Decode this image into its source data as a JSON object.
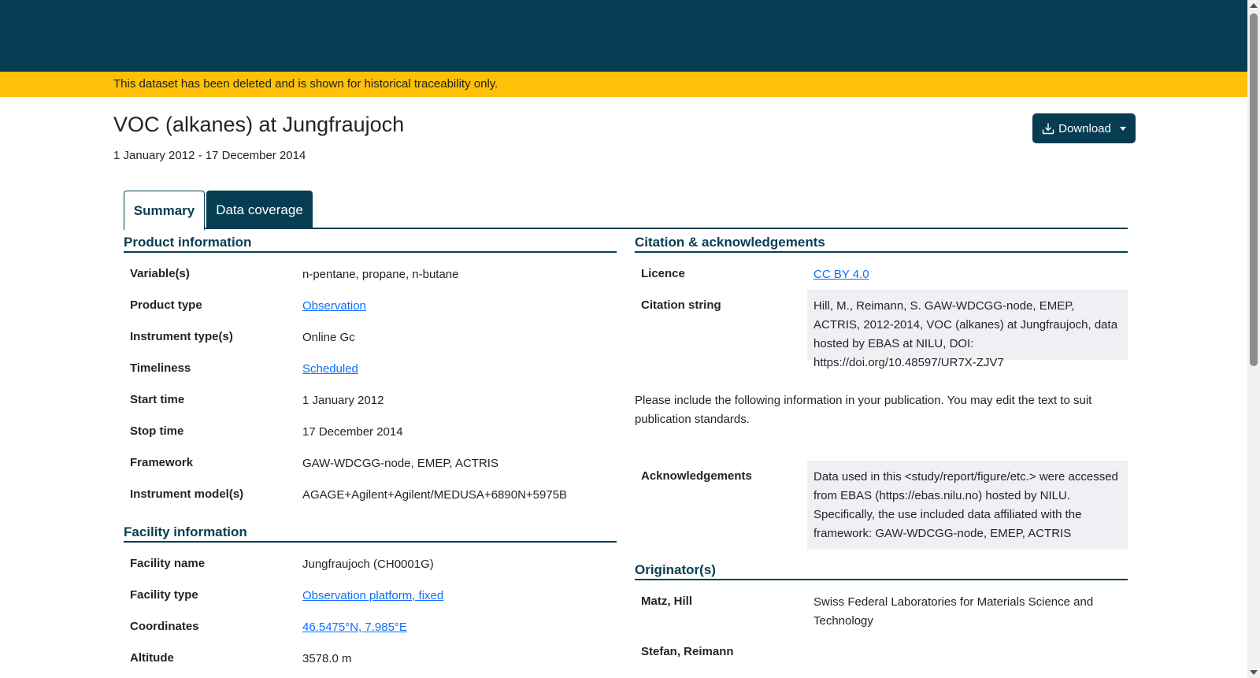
{
  "banner": {
    "alert_text": "This dataset has been deleted and is shown for historical traceability only."
  },
  "header": {
    "title": "VOC (alkanes) at Jungfraujoch",
    "date_range": "1 January 2012 - 17 December 2014",
    "download_label": "Download"
  },
  "tabs": [
    {
      "label": "Summary",
      "active": true
    },
    {
      "label": "Data coverage",
      "active": false
    }
  ],
  "product": {
    "heading": "Product information",
    "rows": [
      {
        "label": "Variable(s)",
        "value": "n-pentane, propane, n-butane"
      },
      {
        "label": "Product type",
        "value": "Observation"
      },
      {
        "label": "Instrument type(s)",
        "value": "Online Gc"
      },
      {
        "label": "Timeliness",
        "value": "Scheduled"
      },
      {
        "label": "Start time",
        "value": "1 January 2012"
      },
      {
        "label": "Stop time",
        "value": "17 December 2014"
      },
      {
        "label": "Framework",
        "value": "GAW-WDCGG-node, EMEP, ACTRIS"
      },
      {
        "label": "Instrument model(s)",
        "value": "AGAGE+Agilent+Agilent/MEDUSA+6890N+5975B"
      }
    ]
  },
  "facility": {
    "heading": "Facility information",
    "rows": [
      {
        "label": "Facility name",
        "value": "Jungfraujoch (CH0001G)"
      },
      {
        "label": "Facility type",
        "value": "Observation platform, fixed"
      },
      {
        "label": "Coordinates",
        "value": "46.5475°N, 7.985°E"
      },
      {
        "label": "Altitude",
        "value": "3578.0 m"
      }
    ]
  },
  "citation": {
    "heading": "Citation & acknowledgements",
    "licence_label": "Licence",
    "licence_value": "CC BY 4.0",
    "citation_label": "Citation string",
    "citation_value": "Hill, M., Reimann, S. GAW-WDCGG-node, EMEP, ACTRIS, 2012-2014, VOC (alkanes) at Jungfraujoch, data hosted by EBAS at NILU, DOI: https://doi.org/10.48597/UR7X-ZJV7",
    "instruction": "Please include the following information in your publication. You may edit the text to suit publication standards.",
    "ack_label": "Acknowledgements",
    "ack_value": "Data used in this <study/report/figure/etc.> were accessed from EBAS (https://ebas.nilu.no) hosted by NILU. Specifically, the use included data affiliated with the framework: GAW-WDCGG-node, EMEP, ACTRIS"
  },
  "originators": {
    "heading": "Originator(s)",
    "rows": [
      {
        "name": "Matz, Hill",
        "org": "Swiss Federal Laboratories for Materials Science and Technology"
      },
      {
        "name": "Stefan, Reimann",
        "org": ""
      }
    ]
  },
  "colors": {
    "brand": "#073d52",
    "alert": "#ffc107",
    "link": "#0d6efd",
    "box": "#eef0f3"
  }
}
